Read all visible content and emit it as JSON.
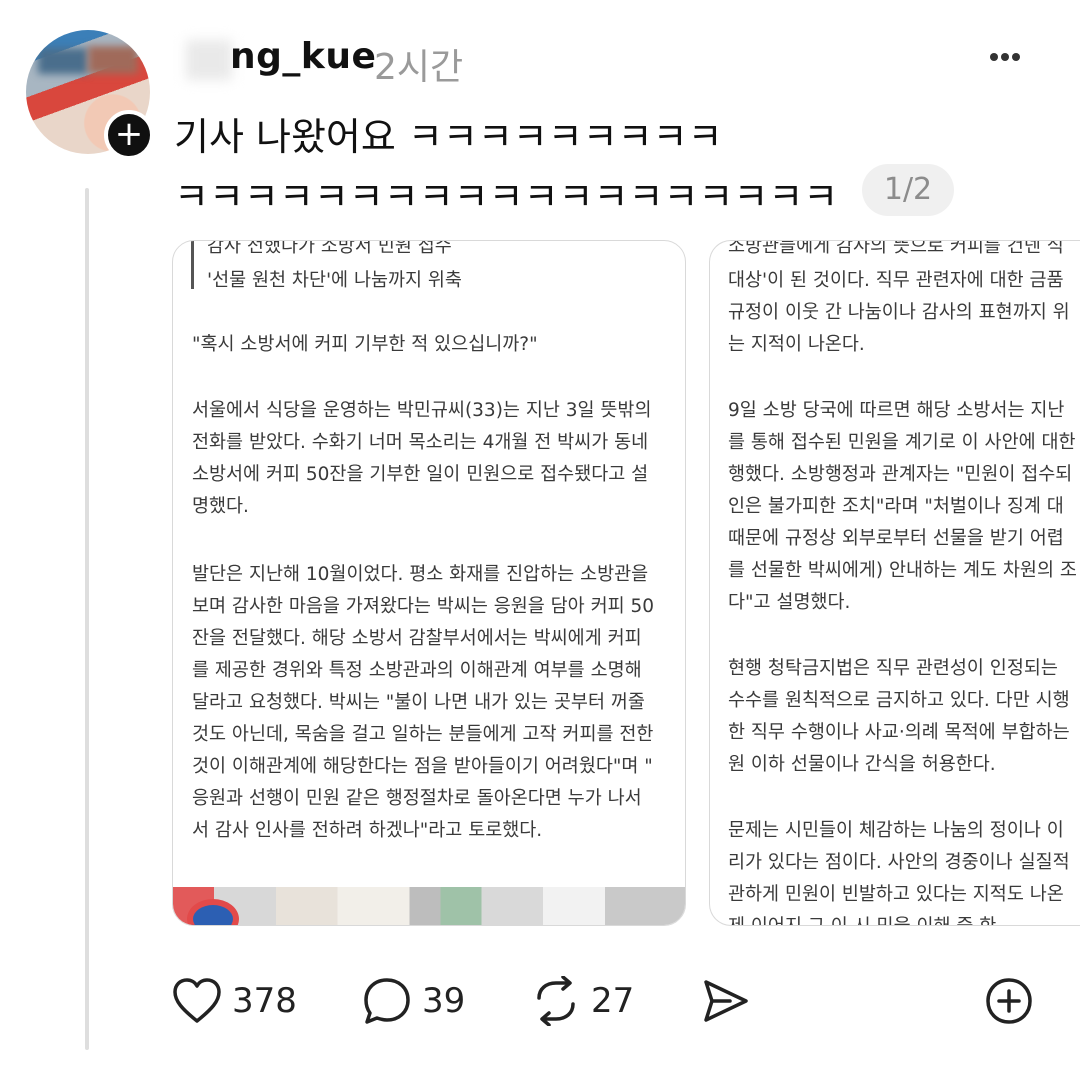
{
  "post": {
    "username_visible": "ng_kue",
    "timestamp": "2시간",
    "text_line1": "기사 나왔어요 ㅋㅋㅋㅋㅋㅋㅋㅋㅋ",
    "text_line2": "ㅋㅋㅋㅋㅋㅋㅋㅋㅋㅋㅋㅋㅋㅋㅋㅋㅋㅋㅋ",
    "image_counter": "1/2"
  },
  "card1": {
    "lines": [
      "감사 전했다가 소방서 민원 접수",
      "'선물 원천 차단'에 나눔까지 위축",
      "\"혹시 소방서에 커피 기부한 적 있으십니까?\"",
      "서울에서 식당을 운영하는 박민규씨(33)는 지난 3일 뜻밖의",
      "전화를 받았다. 수화기 너머 목소리는 4개월 전 박씨가 동네",
      "소방서에 커피 50잔을 기부한 일이 민원으로 접수됐다고 설",
      "명했다.",
      "발단은 지난해 10월이었다. 평소 화재를 진압하는 소방관을",
      "보며 감사한 마음을 가져왔다는 박씨는 응원을 담아 커피 50",
      "잔을 전달했다. 해당 소방서 감찰부서에서는 박씨에게 커피",
      "를 제공한 경위와 특정 소방관과의 이해관계 여부를 소명해",
      "달라고 요청했다. 박씨는 \"불이 나면 내가 있는 곳부터 꺼줄",
      "것도 아닌데, 목숨을 걸고 일하는 분들에게 고작 커피를 전한",
      "것이 이해관계에 해당한다는 점을 받아들이기 어려웠다\"며 \"",
      "응원과 선행이 민원 같은 행정절차로 돌아온다면 누가 나서",
      "서 감사 인사를 전하려 하겠나\"라고 토로했다."
    ]
  },
  "card2": {
    "lines": [
      "소방관들에게 감사의 뜻으로 커피를 건넨 식",
      "대상'이 된 것이다. 직무 관련자에 대한 금품",
      "규정이 이웃 간 나눔이나 감사의 표현까지 위",
      "는 지적이 나온다.",
      "9일 소방 당국에 따르면 해당 소방서는 지난",
      "를 통해 접수된 민원을 계기로 이 사안에 대한",
      "행했다. 소방행정과 관계자는 \"민원이 접수되",
      "인은 불가피한 조치\"라며 \"처벌이나 징계 대",
      "때문에 규정상 외부로부터 선물을 받기 어렵",
      "를 선물한 박씨에게) 안내하는 계도 차원의 조",
      "다\"고 설명했다.",
      "현행 청탁금지법은 직무 관련성이 인정되는 ",
      "수수를 원칙적으로 금지하고 있다. 다만 시행",
      "한 직무 수행이나 사교·의례 목적에 부합하는",
      "원 이하 선물이나 간식을 허용한다.",
      "문제는 시민들이 체감하는 나눔의 정이나 이",
      "리가 있다는 점이다. 사안의 경중이나 실질적",
      "관하게 민원이 빈발하고 있다는 지적도 나온",
      "제 이어지 그 이 시 민을 이해 중 한 "
    ]
  },
  "actions": {
    "likes": "378",
    "comments": "39",
    "reposts": "27"
  }
}
